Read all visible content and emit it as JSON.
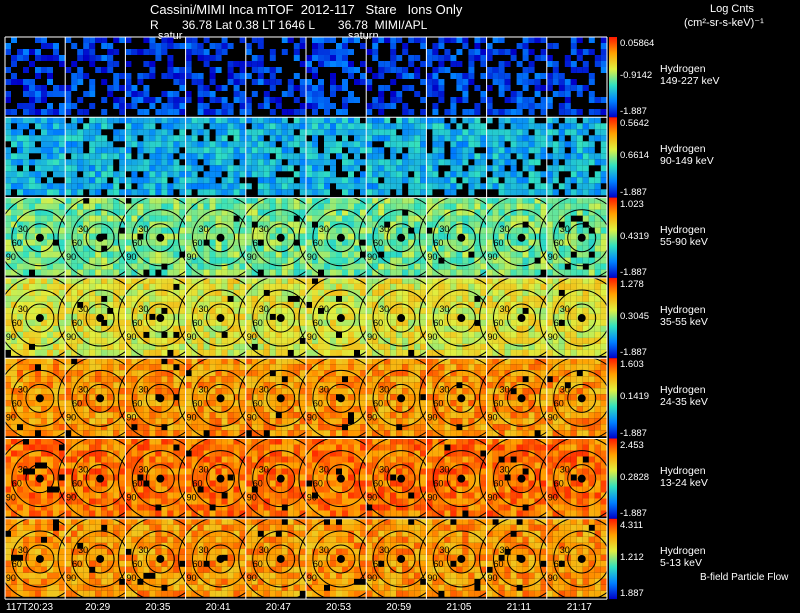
{
  "header": {
    "title": "Cassini/MIMI Inca mTOF  2012-117   Stare   Ions Only",
    "subtitle": "R       36.78 Lat 0.38 LT 1646 L       36.78  MIMI/APL",
    "saturn_label_1": "satur",
    "saturn_label_2": "saturn",
    "log_label": "Log Cnts",
    "log_units": "(cm²-sr-s-keV)⁻¹",
    "footer": "B-field Particle Flow"
  },
  "chart_data": {
    "type": "heatmap",
    "time_labels": [
      "117T20:23",
      "20:29",
      "20:35",
      "20:41",
      "20:47",
      "20:53",
      "20:59",
      "21:05",
      "21:11",
      "21:17"
    ],
    "ring_labels": [
      "30",
      "60",
      "90"
    ],
    "channels": [
      {
        "species": "Hydrogen",
        "energy": "149-227 keV",
        "cb_max": "0.05864",
        "cb_mid": "-0.9142",
        "cb_min": "-1.887"
      },
      {
        "species": "Hydrogen",
        "energy": "90-149 keV",
        "cb_max": "0.5642",
        "cb_mid": "0.6614",
        "cb_min": "-1.887"
      },
      {
        "species": "Hydrogen",
        "energy": "55-90 keV",
        "cb_max": "1.023",
        "cb_mid": "0.4319",
        "cb_min": "-1.887"
      },
      {
        "species": "Hydrogen",
        "energy": "35-55 keV",
        "cb_max": "1.278",
        "cb_mid": "0.3045",
        "cb_min": "-1.887"
      },
      {
        "species": "Hydrogen",
        "energy": "24-35 keV",
        "cb_max": "1.603",
        "cb_mid": "0.1419",
        "cb_min": "-1.887"
      },
      {
        "species": "Hydrogen",
        "energy": "13-24 keV",
        "cb_max": "2.453",
        "cb_mid": "0.2828",
        "cb_min": "-1.887"
      },
      {
        "species": "Hydrogen",
        "energy": "5-13 keV",
        "cb_max": "4.311",
        "cb_mid": "1.212",
        "cb_min": "1.887"
      }
    ],
    "row_intensity": [
      0.1,
      0.3,
      0.48,
      0.62,
      0.8,
      0.86,
      0.8
    ]
  }
}
